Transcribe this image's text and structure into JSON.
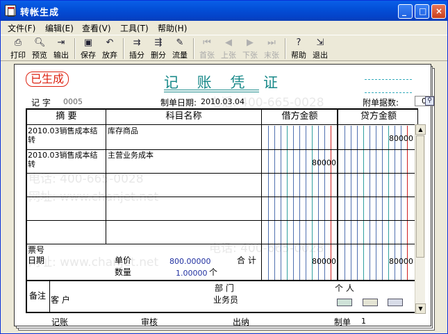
{
  "window": {
    "title": "转帐生成"
  },
  "menu": [
    {
      "label": "文件(F)"
    },
    {
      "label": "编辑(E)"
    },
    {
      "label": "查看(V)"
    },
    {
      "label": "工具(T)"
    },
    {
      "label": "帮助(H)"
    }
  ],
  "toolbar": {
    "print": "打印",
    "preview": "预览",
    "export": "输出",
    "save": "保存",
    "discard": "放弃",
    "insert": "插分",
    "delete": "删分",
    "flow": "流量",
    "first": "首张",
    "prev": "上张",
    "next": "下张",
    "last": "末张",
    "help": "帮助",
    "exit": "退出"
  },
  "voucher": {
    "stamp": "已生成",
    "title": "记 账 凭 证",
    "type_label": "记 字",
    "number": "0005",
    "date_label": "制单日期:",
    "date": "2010.03.04",
    "attach_label": "附单据数:",
    "attach_count": "0"
  },
  "table": {
    "headers": {
      "summary": "摘  要",
      "account": "科目名称",
      "debit": "借方金额",
      "credit": "贷方金额"
    },
    "rows": [
      {
        "summary": "2010.03销售成本结转",
        "account": "库存商品",
        "debit": "",
        "credit": "80000"
      },
      {
        "summary": "2010.03销售成本结转",
        "account": "主营业务成本",
        "debit": "80000",
        "credit": ""
      },
      {
        "summary": "",
        "account": "",
        "debit": "",
        "credit": ""
      },
      {
        "summary": "",
        "account": "",
        "debit": "",
        "credit": ""
      },
      {
        "summary": "",
        "account": "",
        "debit": "",
        "credit": ""
      }
    ],
    "bottom": {
      "ticket_label": "票号",
      "date_label": "日期",
      "price_label": "单价",
      "price": "800.00000",
      "qty_label": "数量",
      "qty": "1.00000",
      "qty_unit": "个",
      "total_label": "合 计",
      "total_debit": "80000",
      "total_credit": "80000"
    },
    "remarks": {
      "label": "备注",
      "dept_label": "部  门",
      "person_label": "个  人",
      "customer_label": "客  户",
      "salesman_label": "业务员"
    }
  },
  "footer": {
    "bookkeeper": "记账",
    "reviewer": "审核",
    "cashier": "出纳",
    "maker_label": "制单",
    "maker": "1"
  },
  "watermark": {
    "phone": "电话: 400-665-0028",
    "site": "网址: www.chanjet.net"
  }
}
